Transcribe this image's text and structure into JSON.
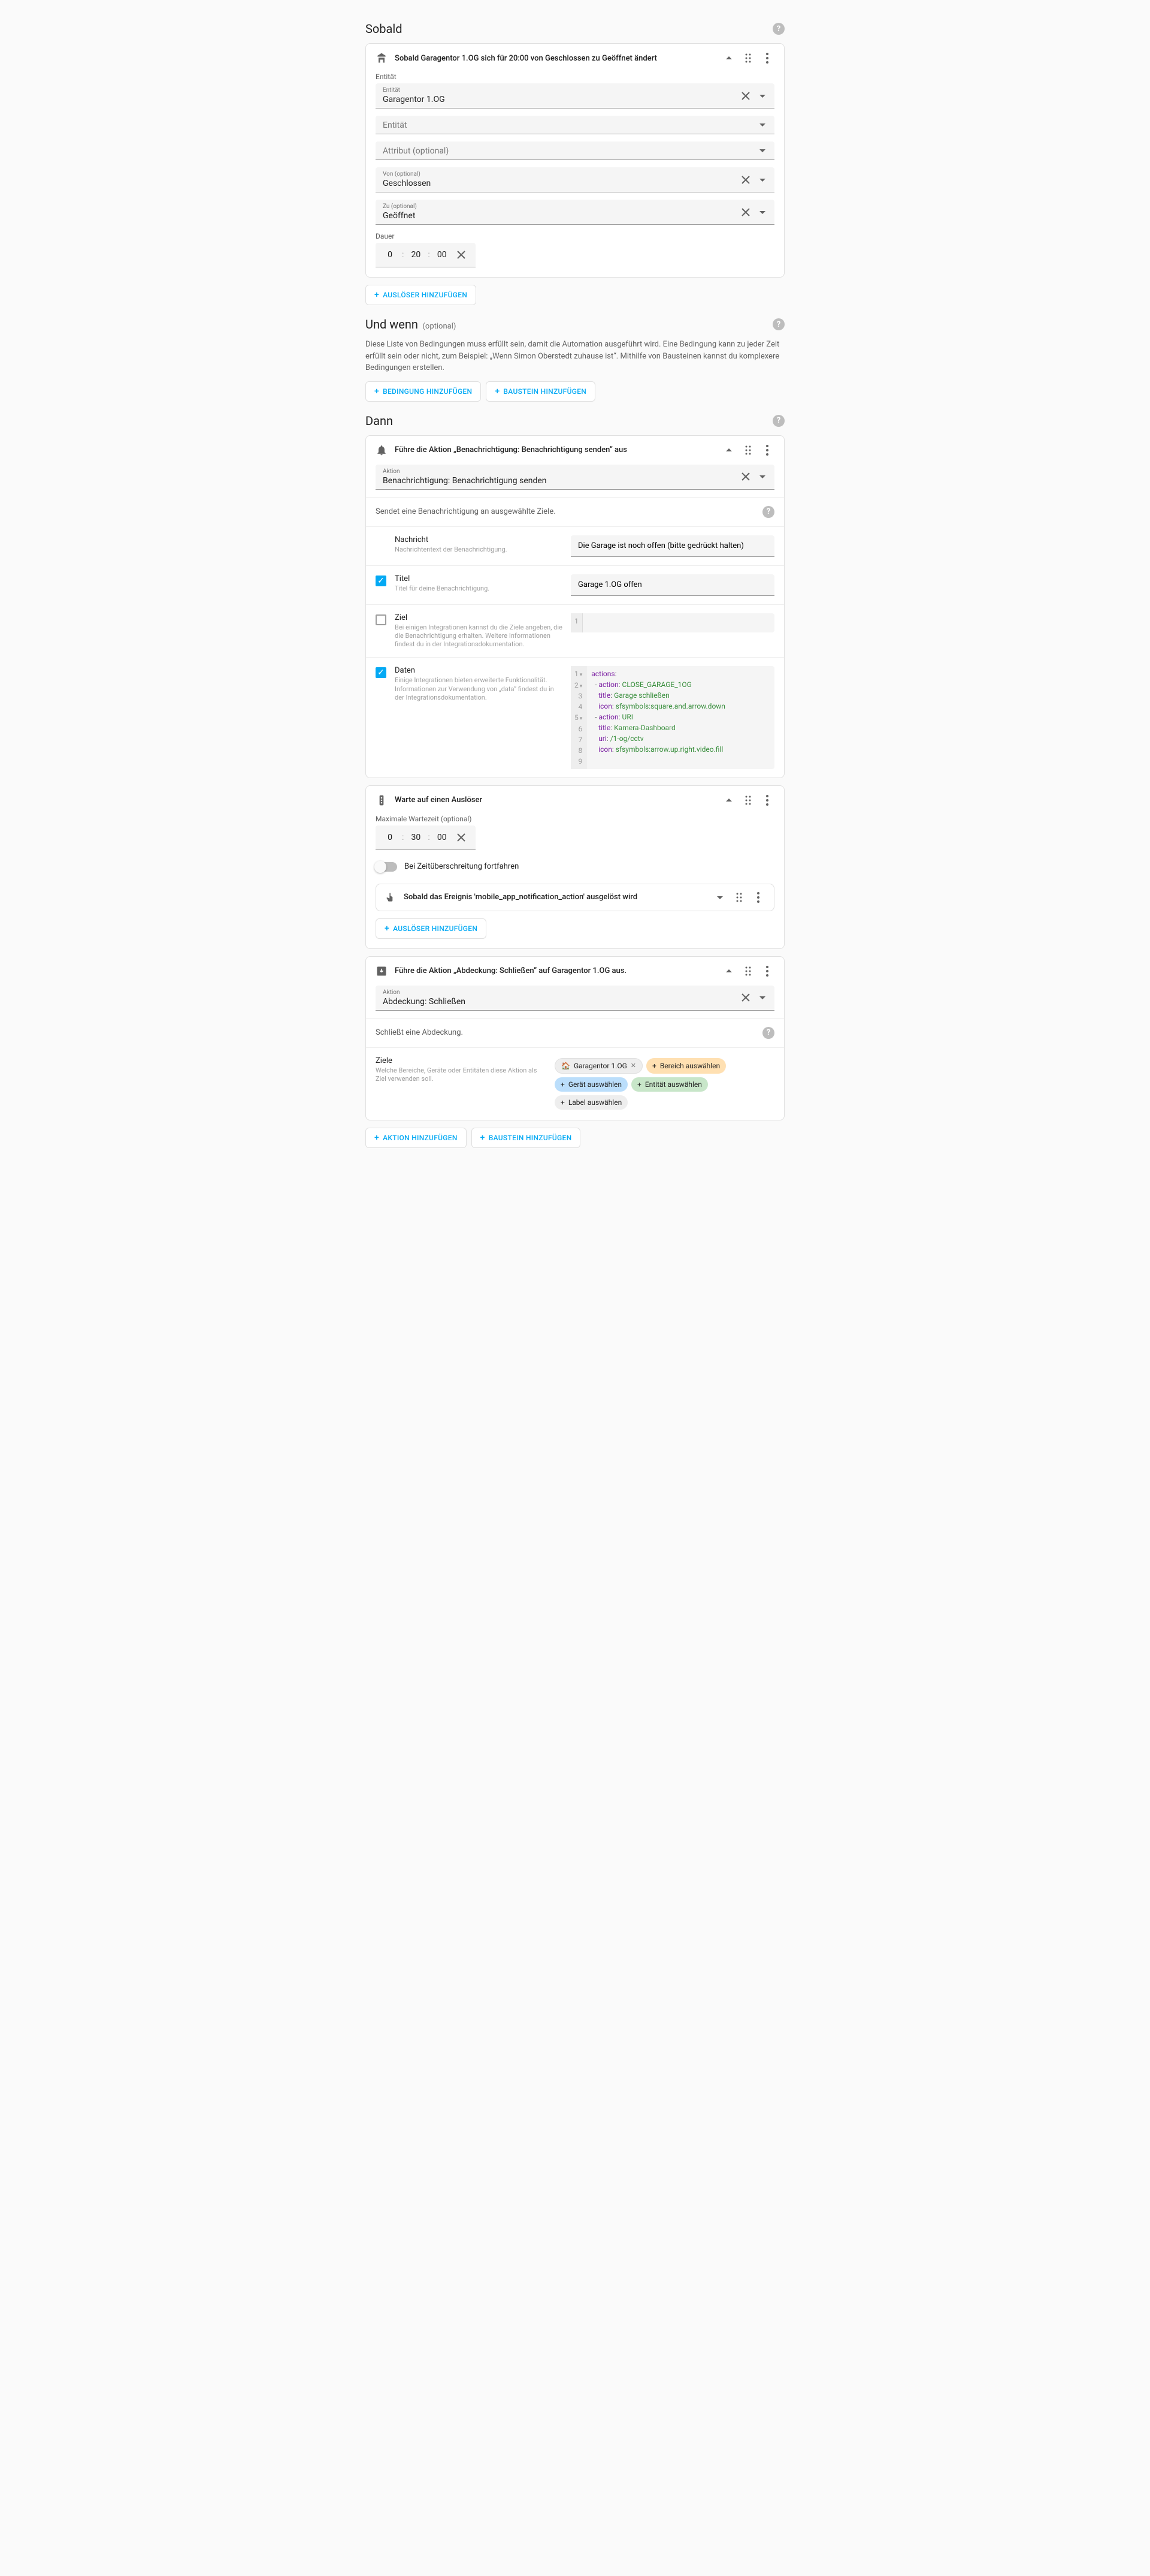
{
  "sections": {
    "trigger": {
      "title": "Sobald"
    },
    "condition": {
      "title": "Und wenn",
      "subtitle": "(optional)"
    },
    "action": {
      "title": "Dann"
    }
  },
  "condition_desc": "Diese Liste von Bedingungen muss erfüllt sein, damit die Automation ausgeführt wird. Eine Bedingung kann zu jeder Zeit erfüllt sein oder nicht, zum Beispiel: „Wenn Simon Oberstedt zuhause ist“. Mithilfe von Bausteinen kannst du komplexere Bedingungen erstellen.",
  "trigger_card": {
    "title": "Sobald Garagentor 1.OG sich für 20:00 von Geschlossen zu Geöffnet ändert",
    "labels": {
      "entity": "Entität",
      "attribute": "Attribut (optional)",
      "from": "Von (optional)",
      "to": "Zu (optional)",
      "duration": "Dauer"
    },
    "entity_value": "Garagentor 1.OG",
    "from_value": "Geschlossen",
    "to_value": "Geöffnet",
    "duration": {
      "h": "0",
      "m": "20",
      "s": "00"
    }
  },
  "buttons": {
    "add_trigger": "AUSLÖSER HINZUFÜGEN",
    "add_condition": "BEDINGUNG HINZUFÜGEN",
    "add_block": "BAUSTEIN HINZUFÜGEN",
    "add_action": "AKTION HINZUFÜGEN"
  },
  "action1": {
    "title": "Führe die Aktion „Benachrichtigung: Benachrichtigung senden“ aus",
    "action_label": "Aktion",
    "action_value": "Benachrichtigung: Benachrichtigung senden",
    "desc": "Sendet eine Benachrichtigung an ausgewählte Ziele.",
    "fields": {
      "message": {
        "label": "Nachricht",
        "desc": "Nachrichtentext der Benachrichtigung.",
        "value": "Die Garage ist noch offen (bitte gedrückt halten)"
      },
      "title": {
        "label": "Titel",
        "desc": "Titel für deine Benachrichtigung.",
        "value": "Garage 1.OG offen",
        "checked": true
      },
      "target": {
        "label": "Ziel",
        "desc": "Bei einigen Integrationen kannst du die Ziele angeben, die die Benachrichtigung erhalten. Weitere Informationen findest du in der Integrationsdokumentation.",
        "checked": false
      },
      "data": {
        "label": "Daten",
        "desc": "Einige Integrationen bieten erweiterte Funktionalität. Informationen zur Verwendung von „data“ findest du in der Integrationsdokumentation.",
        "checked": true
      }
    },
    "code": {
      "lines": [
        "1",
        "2",
        "3",
        "4",
        "5",
        "6",
        "7",
        "8",
        "9"
      ],
      "l1_k": "actions",
      "l1_p": ":",
      "l2_k": "action",
      "l2_p": ": ",
      "l2_v": "CLOSE_GARAGE_1OG",
      "l3_k": "title",
      "l3_p": ": ",
      "l3_v": "Garage schließen",
      "l4_k": "icon",
      "l4_p": ": ",
      "l4_v": "sfsymbols:square.and.arrow.down",
      "l5_k": "action",
      "l5_p": ": ",
      "l5_v": "URI",
      "l6_k": "title",
      "l6_p": ": ",
      "l6_v": "Kamera-Dashboard",
      "l7_k": "uri",
      "l7_p": ": ",
      "l7_v": "/1-og/cctv",
      "l8_k": "icon",
      "l8_p": ": ",
      "l8_v": "sfsymbols:arrow.up.right.video.fill"
    }
  },
  "action2": {
    "title": "Warte auf einen Auslöser",
    "max_wait_label": "Maximale Wartezeit (optional)",
    "duration": {
      "h": "0",
      "m": "30",
      "s": "00"
    },
    "timeout_label": "Bei Zeitüberschreitung fortfahren",
    "nested_trigger": "Sobald das Ereignis 'mobile_app_notification_action' ausgelöst wird"
  },
  "action3": {
    "title": "Führe die Aktion „Abdeckung: Schließen“ auf Garagentor 1.OG aus.",
    "action_label": "Aktion",
    "action_value": "Abdeckung: Schließen",
    "desc": "Schließt eine Abdeckung.",
    "targets": {
      "label": "Ziele",
      "desc": "Welche Bereiche, Geräte oder Entitäten diese Aktion als Ziel verwenden soll.",
      "entity_chip": "Garagentor 1.OG",
      "area": "Bereich auswählen",
      "device": "Gerät auswählen",
      "entity": "Entität auswählen",
      "label_chip": "Label auswählen"
    }
  }
}
